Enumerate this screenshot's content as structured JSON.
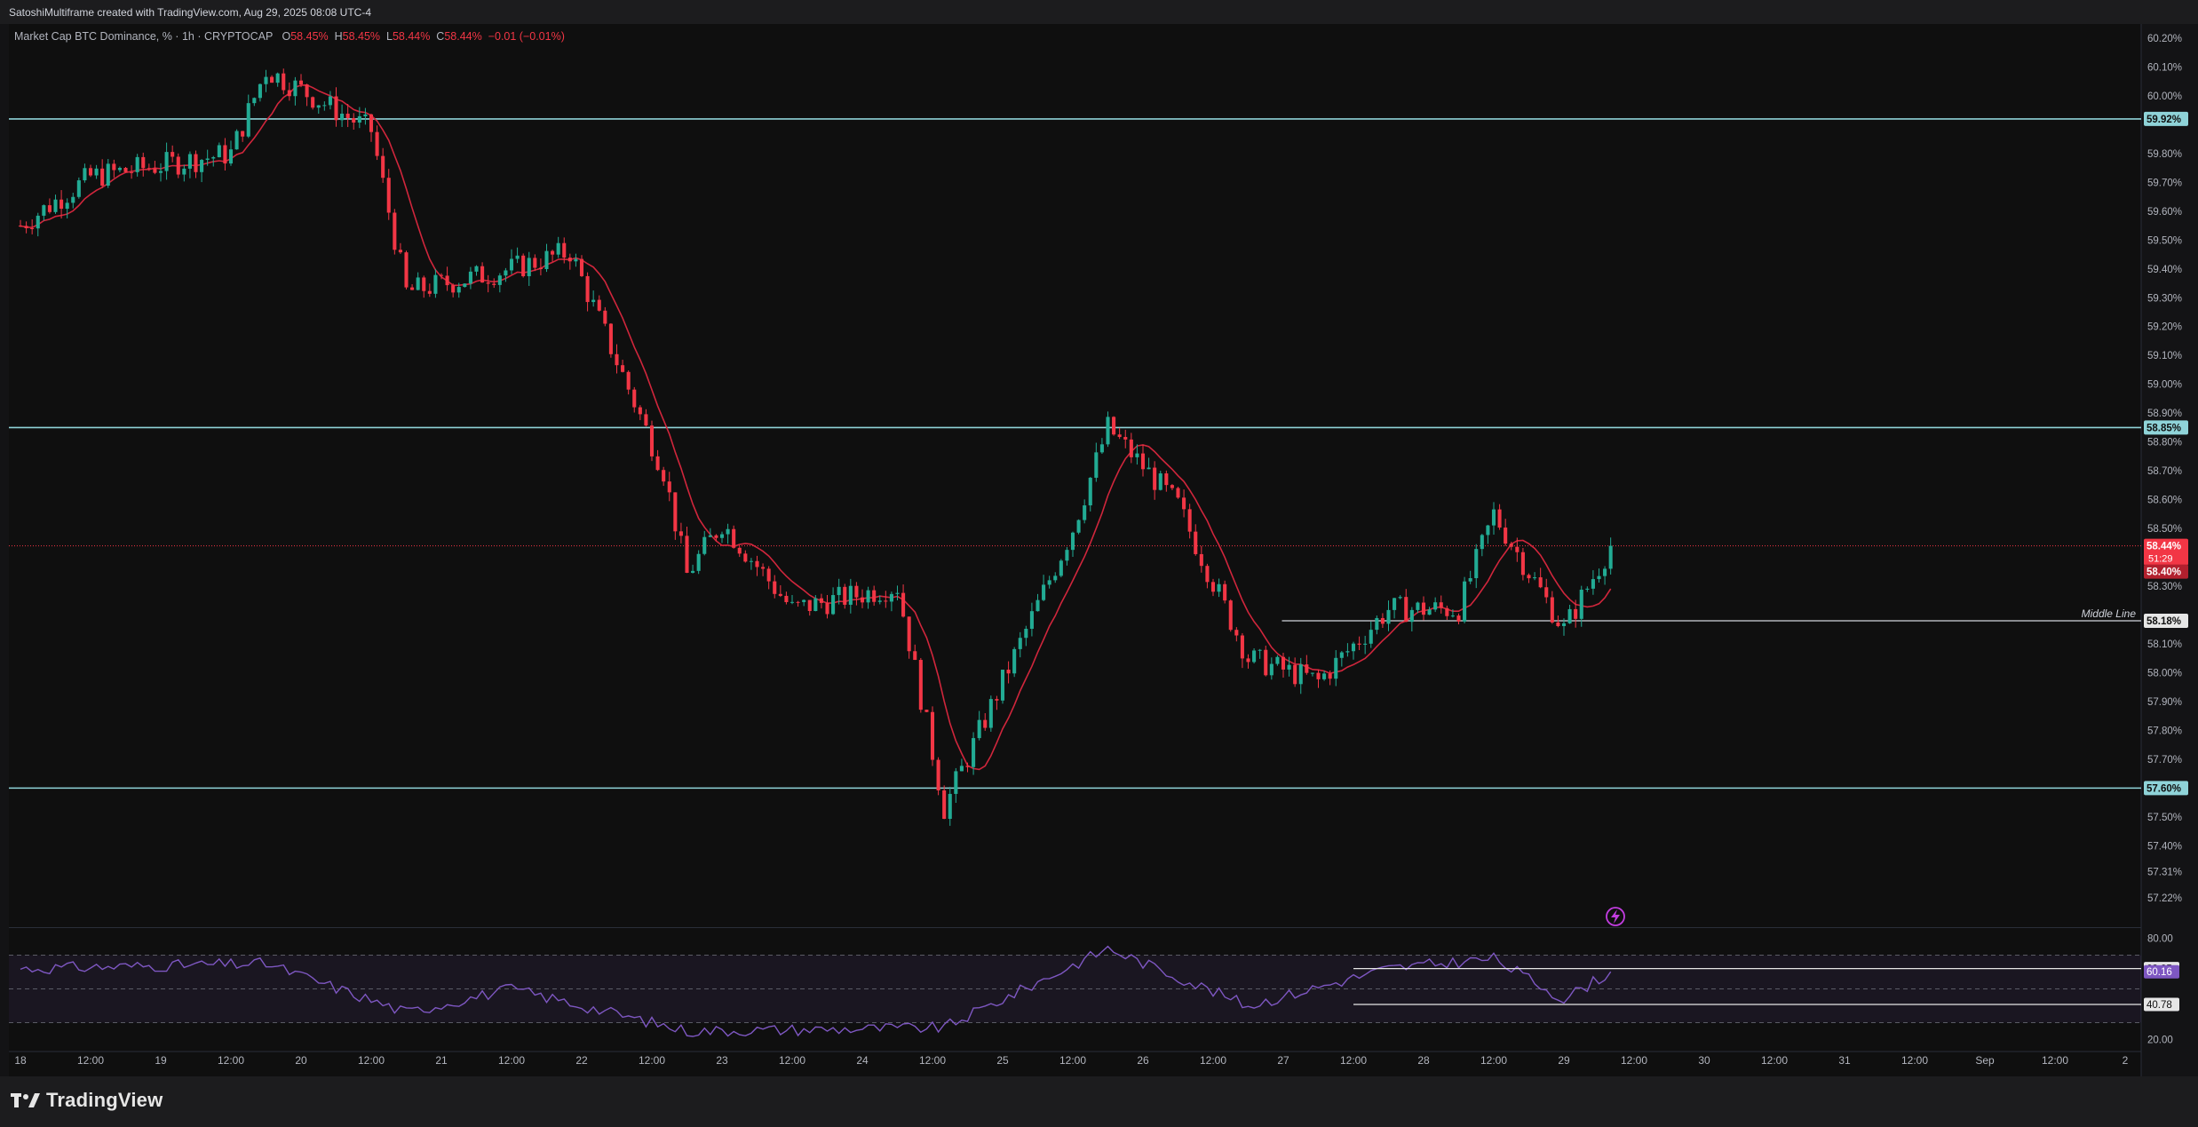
{
  "header": {
    "title": "SatoshiMultiframe created with TradingView.com, Aug 29, 2025 08:08 UTC-4"
  },
  "legend": {
    "symbol": "Market Cap BTC Dominance, % · 1h · CRYPTOCAP",
    "open_label": "O",
    "open_value": "58.45%",
    "high_label": "H",
    "high_value": "58.45%",
    "low_label": "L",
    "low_value": "58.44%",
    "close_label": "C",
    "close_value": "58.44%",
    "change": "−0.01 (−0.01%)"
  },
  "footer": {
    "brand": "TradingView"
  },
  "colors": {
    "background": "#0f0f0f",
    "up": "#22ab94",
    "down": "#f23645",
    "ma": "#d0263c",
    "level": "#8fd3d8",
    "rsi": "#7e57c2"
  },
  "chart_data": [
    {
      "type": "candlestick",
      "timeframe": "1h",
      "ylim": [
        57.13,
        60.24
      ],
      "price_axis_ticks": [
        "60.20%",
        "60.10%",
        "60.00%",
        "59.80%",
        "59.70%",
        "59.60%",
        "59.50%",
        "59.40%",
        "59.30%",
        "59.20%",
        "59.10%",
        "59.00%",
        "58.90%",
        "58.80%",
        "58.70%",
        "58.60%",
        "58.50%",
        "58.30%",
        "58.10%",
        "58.00%",
        "57.90%",
        "57.80%",
        "57.70%",
        "57.50%",
        "57.40%",
        "57.31%",
        "57.22%"
      ],
      "time_axis_ticks": [
        "18",
        "12:00",
        "19",
        "12:00",
        "20",
        "12:00",
        "21",
        "12:00",
        "22",
        "12:00",
        "23",
        "12:00",
        "24",
        "12:00",
        "25",
        "12:00",
        "26",
        "12:00",
        "27",
        "12:00",
        "28",
        "12:00",
        "29",
        "12:00",
        "30",
        "12:00",
        "31",
        "12:00",
        "Sep",
        "12:00",
        "2"
      ],
      "horizontal_levels": [
        {
          "value": 59.92,
          "label": "59.92%"
        },
        {
          "value": 58.85,
          "label": "58.85%"
        },
        {
          "value": 57.6,
          "label": "57.60%"
        }
      ],
      "middle_line": {
        "value": 58.18,
        "label": "58.18%",
        "text": "Middle Line"
      },
      "current_price": {
        "value": 58.44,
        "label": "58.44%",
        "countdown": "51:29"
      },
      "ma_price": {
        "value": 58.4,
        "label": "58.40%"
      },
      "key_points": [
        {
          "time": "Aug 18 00:00",
          "close": 59.55
        },
        {
          "time": "Aug 18 12:00",
          "close": 59.72
        },
        {
          "time": "Aug 19 12:00",
          "close": 59.8
        },
        {
          "time": "Aug 19 18:00",
          "high": 60.09
        },
        {
          "time": "Aug 20 12:00",
          "close": 59.88
        },
        {
          "time": "Aug 20 18:00",
          "close": 59.32
        },
        {
          "time": "Aug 21 12:00",
          "close": 59.4
        },
        {
          "time": "Aug 21 22:00",
          "close": 59.46
        },
        {
          "time": "Aug 22 14:00",
          "close": 58.7
        },
        {
          "time": "Aug 22 18:00",
          "close": 58.34
        },
        {
          "time": "Aug 23 00:00",
          "close": 58.52
        },
        {
          "time": "Aug 23 12:00",
          "close": 58.22
        },
        {
          "time": "Aug 24 06:00",
          "close": 58.3
        },
        {
          "time": "Aug 24 14:00",
          "low": 57.53
        },
        {
          "time": "Aug 25 00:00",
          "close": 57.97
        },
        {
          "time": "Aug 25 12:00",
          "close": 58.5
        },
        {
          "time": "Aug 25 18:00",
          "high": 58.85
        },
        {
          "time": "Aug 26 06:00",
          "close": 58.58
        },
        {
          "time": "Aug 26 18:00",
          "close": 58.05
        },
        {
          "time": "Aug 27 06:00",
          "close": 57.97
        },
        {
          "time": "Aug 27 18:00",
          "close": 58.22
        },
        {
          "time": "Aug 28 06:00",
          "close": 58.22
        },
        {
          "time": "Aug 28 12:00",
          "high": 58.55
        },
        {
          "time": "Aug 29 00:00",
          "low": 58.15
        },
        {
          "time": "Aug 29 08:00",
          "close": 58.44
        }
      ]
    },
    {
      "type": "line",
      "name": "RSI",
      "ylim": [
        15,
        85
      ],
      "axis_ticks": [
        "80.00",
        "20.00"
      ],
      "bands": {
        "upper": 70,
        "middle": 50,
        "lower": 30
      },
      "levels": [
        {
          "value": 62.05,
          "label": "62.05"
        },
        {
          "value": 40.78,
          "label": "40.78"
        }
      ],
      "current": {
        "value": 60.16,
        "label": "60.16"
      },
      "key_points": [
        {
          "time": "Aug 18 00:00",
          "value": 62
        },
        {
          "time": "Aug 19 18:00",
          "value": 65
        },
        {
          "time": "Aug 20 18:00",
          "value": 36
        },
        {
          "time": "Aug 21 12:00",
          "value": 50
        },
        {
          "time": "Aug 22 18:00",
          "value": 25
        },
        {
          "time": "Aug 24 14:00",
          "value": 27
        },
        {
          "time": "Aug 25 18:00",
          "value": 74
        },
        {
          "time": "Aug 26 18:00",
          "value": 40
        },
        {
          "time": "Aug 27 18:00",
          "value": 62
        },
        {
          "time": "Aug 28 12:00",
          "value": 68
        },
        {
          "time": "Aug 29 00:00",
          "value": 44
        },
        {
          "time": "Aug 29 08:00",
          "value": 60
        }
      ]
    }
  ]
}
